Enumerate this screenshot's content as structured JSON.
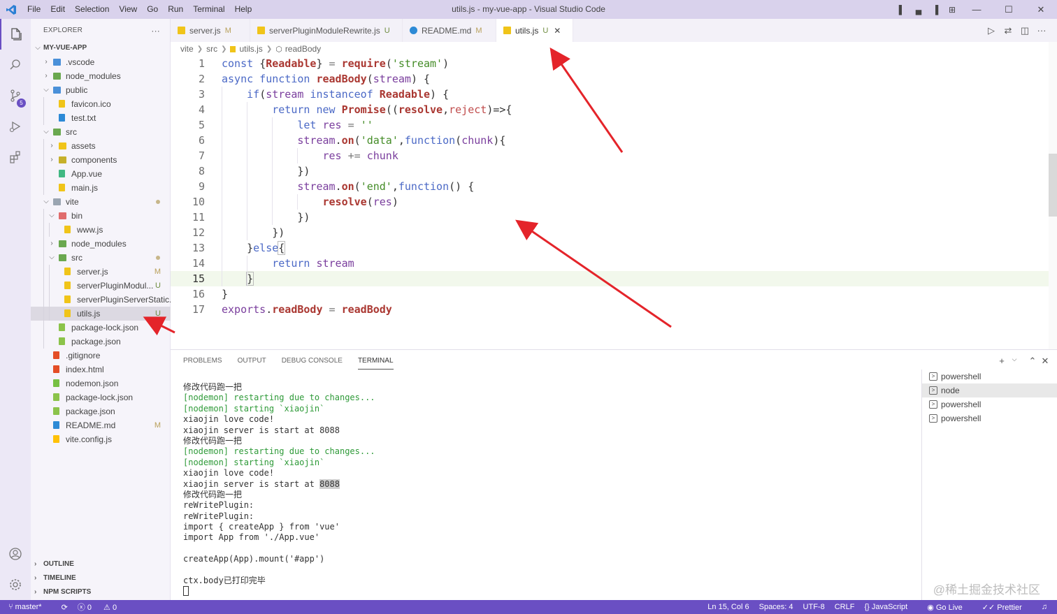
{
  "window": {
    "title": "utils.js - my-vue-app - Visual Studio Code",
    "menu": [
      "File",
      "Edit",
      "Selection",
      "View",
      "Go",
      "Run",
      "Terminal",
      "Help"
    ]
  },
  "colors": {
    "accent": "#6a4fc3",
    "titlebar": "#d9d2ec",
    "modified": "#b9a05a",
    "untracked": "#6e8c3f"
  },
  "activity": {
    "scm_badge": "5"
  },
  "explorer": {
    "header": "EXPLORER",
    "more": "···",
    "root": "MY-VUE-APP",
    "items": [
      {
        "label": ".vscode",
        "status": "",
        "icon": "folder-vscode-icon"
      },
      {
        "label": "node_modules",
        "status": "",
        "icon": "folder-node-icon"
      },
      {
        "label": "public",
        "status": "",
        "icon": "folder-public-icon"
      },
      {
        "label": "favicon.ico",
        "status": "",
        "icon": "star-file-icon"
      },
      {
        "label": "test.txt",
        "status": "",
        "icon": "text-file-icon"
      },
      {
        "label": "src",
        "status": "",
        "icon": "folder-src-icon"
      },
      {
        "label": "assets",
        "status": "",
        "icon": "folder-assets-icon"
      },
      {
        "label": "components",
        "status": "",
        "icon": "folder-components-icon"
      },
      {
        "label": "App.vue",
        "status": "",
        "icon": "vue-file-icon"
      },
      {
        "label": "main.js",
        "status": "",
        "icon": "js-file-icon"
      },
      {
        "label": "vite",
        "status": "",
        "icon": "folder-icon"
      },
      {
        "label": "bin",
        "status": "",
        "icon": "folder-bin-icon"
      },
      {
        "label": "www.js",
        "status": "",
        "icon": "js-file-icon"
      },
      {
        "label": "node_modules",
        "status": "",
        "icon": "folder-node-icon"
      },
      {
        "label": "src",
        "status": "",
        "icon": "folder-src-icon"
      },
      {
        "label": "server.js",
        "status": "M",
        "icon": "js-file-icon"
      },
      {
        "label": "serverPluginModul...",
        "status": "U",
        "icon": "js-file-icon"
      },
      {
        "label": "serverPluginServerStatic...",
        "status": "",
        "icon": "js-file-icon"
      },
      {
        "label": "utils.js",
        "status": "U",
        "icon": "js-file-icon"
      },
      {
        "label": "package-lock.json",
        "status": "",
        "icon": "json-node-icon"
      },
      {
        "label": "package.json",
        "status": "",
        "icon": "json-node-icon"
      },
      {
        "label": ".gitignore",
        "status": "",
        "icon": "git-icon"
      },
      {
        "label": "index.html",
        "status": "",
        "icon": "html-file-icon"
      },
      {
        "label": "nodemon.json",
        "status": "",
        "icon": "nodemon-icon"
      },
      {
        "label": "package-lock.json",
        "status": "",
        "icon": "json-node-icon"
      },
      {
        "label": "package.json",
        "status": "",
        "icon": "json-node-icon"
      },
      {
        "label": "README.md",
        "status": "M",
        "icon": "info-icon"
      },
      {
        "label": "vite.config.js",
        "status": "",
        "icon": "vite-icon"
      }
    ],
    "sections": [
      "OUTLINE",
      "TIMELINE",
      "NPM SCRIPTS"
    ]
  },
  "tabs": [
    {
      "label": "server.js",
      "status": "M"
    },
    {
      "label": "serverPluginModuleRewrite.js",
      "status": "U"
    },
    {
      "label": "README.md",
      "status": "M"
    },
    {
      "label": "utils.js",
      "status": "U",
      "close": "✕"
    }
  ],
  "breadcrumb": [
    "vite",
    "src",
    "utils.js",
    "readBody"
  ],
  "code": {
    "current_line": 15,
    "line_numbers": [
      "1",
      "2",
      "3",
      "4",
      "5",
      "6",
      "7",
      "8",
      "9",
      "10",
      "11",
      "12",
      "13",
      "14",
      "15",
      "16",
      "17"
    ]
  },
  "panel": {
    "tabs": [
      "PROBLEMS",
      "OUTPUT",
      "DEBUG CONSOLE",
      "TERMINAL"
    ],
    "terminal_lines": [
      "修改代码跑一把",
      "[nodemon] restarting due to changes...",
      "[nodemon] starting `xiaojin`",
      "xiaojin love code!",
      "xiaojin server is start at 8088",
      "修改代码跑一把",
      "[nodemon] restarting due to changes...",
      "[nodemon] starting `xiaojin`",
      "xiaojin love code!",
      "xiaojin server is start at ",
      "修改代码跑一把",
      "reWritePlugin:",
      "reWritePlugin:",
      "import { createApp } from 'vue'",
      "import App from './App.vue'",
      "",
      "createApp(App).mount('#app')",
      "",
      "ctx.body已打印完毕"
    ],
    "highlight": "8088",
    "terminals": [
      "powershell",
      "node",
      "powershell",
      "powershell"
    ],
    "watermark": "@稀土掘金技术社区"
  },
  "status": {
    "branch": "master*",
    "errors": "0",
    "warnings": "0",
    "position": "Ln 15, Col 6",
    "spaces": "Spaces: 4",
    "encoding": "UTF-8",
    "eol": "CRLF",
    "language": "JavaScript",
    "golive": "Go Live",
    "prettier": "Prettier"
  }
}
